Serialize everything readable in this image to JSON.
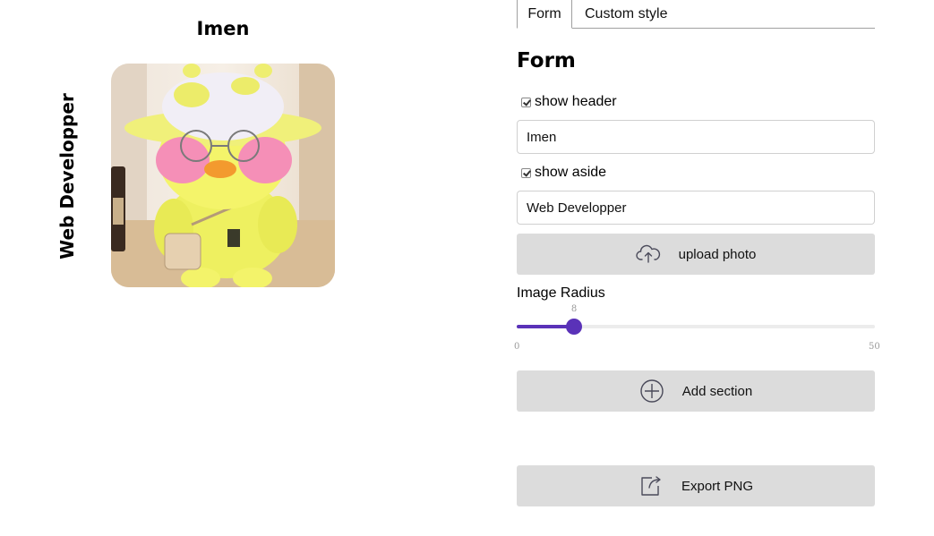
{
  "preview": {
    "header": "Imen",
    "aside": "Web Developper",
    "photo_alt": "yellow duck plush with pink cheeks, glasses and hat"
  },
  "tabs": [
    {
      "label": "Form",
      "active": true
    },
    {
      "label": "Custom style",
      "active": false
    }
  ],
  "form": {
    "heading": "Form",
    "show_header": {
      "label": "show header",
      "checked": true
    },
    "header_value": "Imen",
    "show_aside": {
      "label": "show aside",
      "checked": true
    },
    "aside_value": "Web Developper",
    "upload_label": "upload photo",
    "slider": {
      "label": "Image Radius",
      "value": 8,
      "min": 0,
      "max": 50,
      "min_label": "0",
      "max_label": "50",
      "value_label": "8"
    },
    "add_section_label": "Add section",
    "export_label": "Export PNG"
  },
  "colors": {
    "accent": "#5a32b8",
    "button_bg": "#dcdcdc"
  },
  "icons": {
    "upload": "cloud-upload-icon",
    "add": "plus-circle-icon",
    "export": "export-icon"
  }
}
